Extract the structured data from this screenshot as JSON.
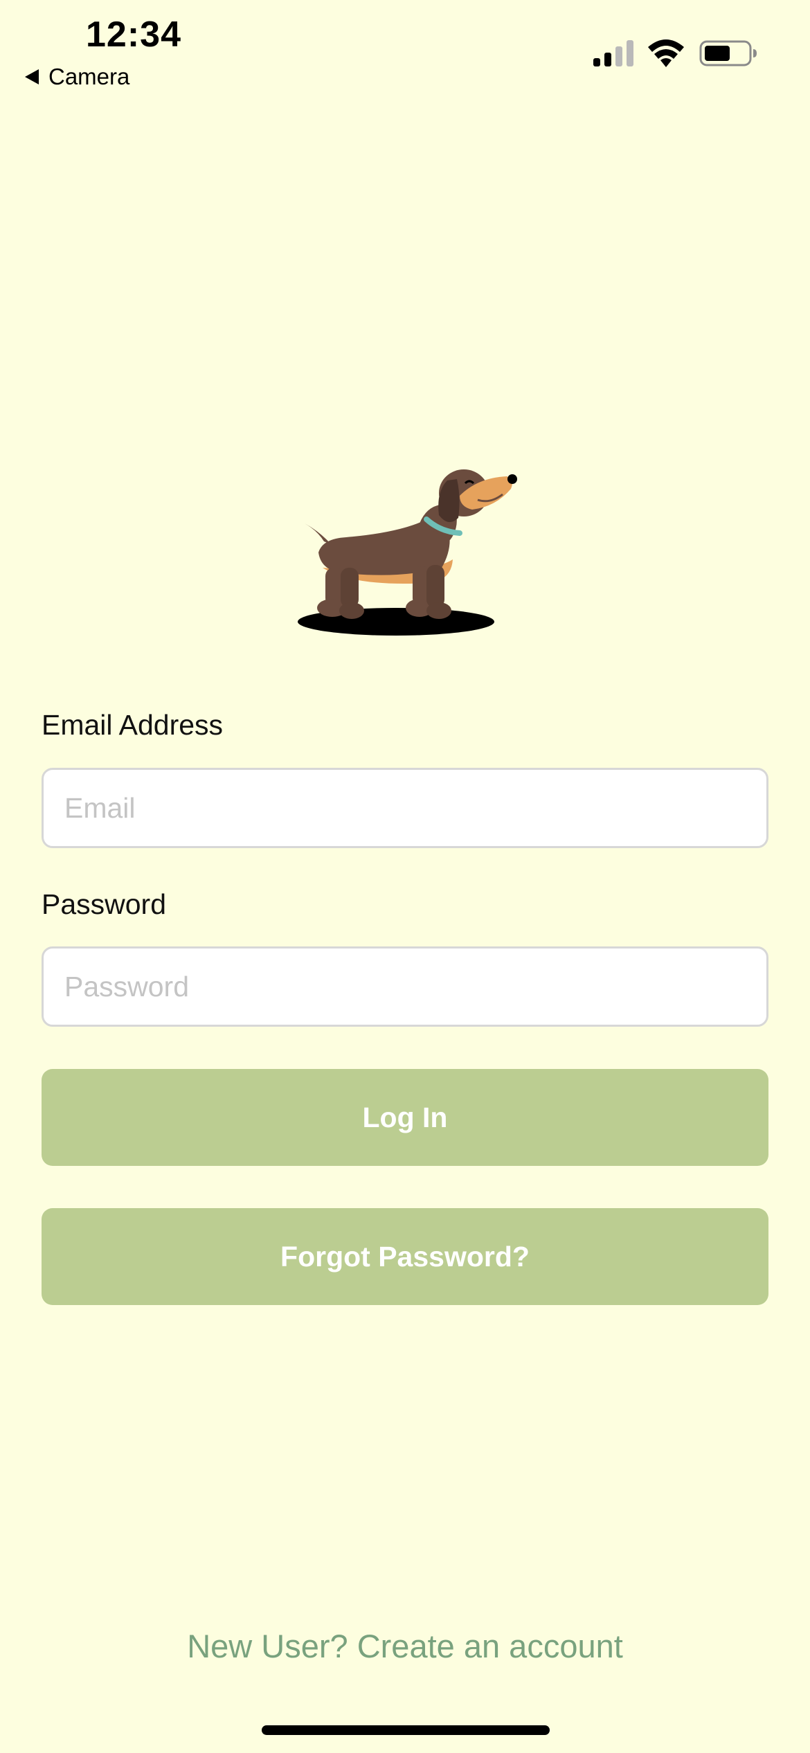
{
  "status_bar": {
    "time": "12:34",
    "back_app_label": "Camera",
    "signal_icon": "cellular-signal-icon",
    "wifi_icon": "wifi-icon",
    "battery_icon": "battery-icon"
  },
  "mascot": {
    "icon": "dachshund-dog-illustration"
  },
  "login_form": {
    "email_label": "Email Address",
    "email_placeholder": "Email",
    "email_value": "",
    "password_label": "Password",
    "password_placeholder": "Password",
    "password_value": "",
    "login_button_label": "Log In",
    "forgot_button_label": "Forgot Password?"
  },
  "footer": {
    "signup_link_label": "New User? Create an account"
  },
  "colors": {
    "background": "#fdfedf",
    "button_green": "#bbcd91",
    "link_green": "#79a27e",
    "dog_brown": "#6b4c3e",
    "dog_tan": "#e6a25c",
    "collar_teal": "#6fbfb7"
  }
}
